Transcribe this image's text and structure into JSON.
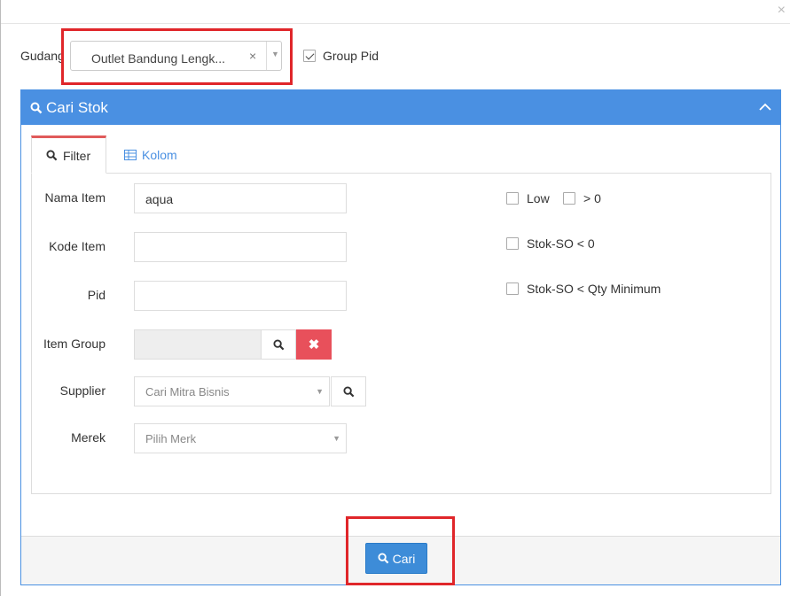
{
  "header": {
    "close_label": "×"
  },
  "gudang": {
    "label": "Gudang",
    "value": "Outlet Bandung Lengk...",
    "clear": "×"
  },
  "group_pid": {
    "label": "Group Pid",
    "checked": true
  },
  "panel": {
    "title": "Cari Stok"
  },
  "tabs": [
    {
      "label": "Filter",
      "active": true
    },
    {
      "label": "Kolom",
      "active": false
    }
  ],
  "form": {
    "nama_item": {
      "label": "Nama Item",
      "value": "aqua"
    },
    "kode_item": {
      "label": "Kode Item",
      "value": ""
    },
    "pid": {
      "label": "Pid",
      "value": ""
    },
    "item_group": {
      "label": "Item Group",
      "value": ""
    },
    "supplier": {
      "label": "Supplier",
      "placeholder": "Cari Mitra Bisnis"
    },
    "merek": {
      "label": "Merek",
      "placeholder": "Pilih Merk"
    }
  },
  "checks": {
    "low": "Low",
    "gt0": "> 0",
    "stok_so_lt0": "Stok-SO < 0",
    "stok_so_lt_min": "Stok-SO < Qty Minimum"
  },
  "footer": {
    "cari_label": "Cari"
  },
  "colors": {
    "accent": "#4a90e2",
    "danger": "#e8505b",
    "highlight": "#e0262a",
    "button": "#3d8cd8"
  }
}
